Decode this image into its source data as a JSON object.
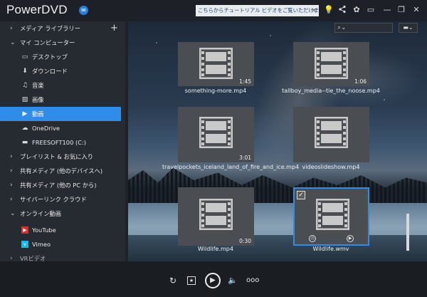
{
  "app": {
    "title": "PowerDVD",
    "badge_glyph": "✉"
  },
  "notice": {
    "text": "こちらからチュートリアル ビデオをご覧いただけます。",
    "close": "×"
  },
  "titlebar_icons": [
    "bulb-icon",
    "share-icon",
    "settings-icon",
    "display-icon",
    "minimize-icon",
    "restore-icon",
    "close-icon"
  ],
  "sidebar": {
    "media_library": "メディア ライブラリー",
    "my_computer": "マイ コンピューター",
    "items": [
      {
        "label": "デスクトップ",
        "icon": "desktop-icon"
      },
      {
        "label": "ダウンロード",
        "icon": "download-icon"
      },
      {
        "label": "音楽",
        "icon": "music-icon"
      },
      {
        "label": "画像",
        "icon": "image-icon"
      },
      {
        "label": "動画",
        "icon": "video-icon",
        "active": true
      },
      {
        "label": "OneDrive",
        "icon": "cloud-icon"
      },
      {
        "label": "FREESOFT100 (C:)",
        "icon": "drive-icon"
      }
    ],
    "playlist": "プレイリスト & お気に入り",
    "shared_devices": "共有メディア (他のデバイスへ)",
    "shared_pc": "共有メディア (他の PC から)",
    "cyberlink_cloud": "サイバーリンク クラウド",
    "online_video": "オンライン動画",
    "youtube": "YouTube",
    "vimeo": "Vimeo",
    "cut_off": "VRビデオ"
  },
  "tiles": [
    {
      "name": "something-more.mp4",
      "duration": "1:45"
    },
    {
      "name": "tallboy_media--tie_the_noose.mp4",
      "duration": "1:06"
    },
    {
      "name": "travelpockets_iceland_land_of_fire_and_ice.mp4",
      "duration": "3:01"
    },
    {
      "name": "videoslideshow.mp4",
      "duration": ""
    },
    {
      "name": "Wildlife.mp4",
      "duration": "0:30"
    },
    {
      "name": "Wildlife.wmv",
      "duration": "",
      "selected": true
    }
  ],
  "colors": {
    "accent": "#2f8ce8",
    "sidebar_bg": "#262b32",
    "tile_bg": "#4a4d51"
  }
}
